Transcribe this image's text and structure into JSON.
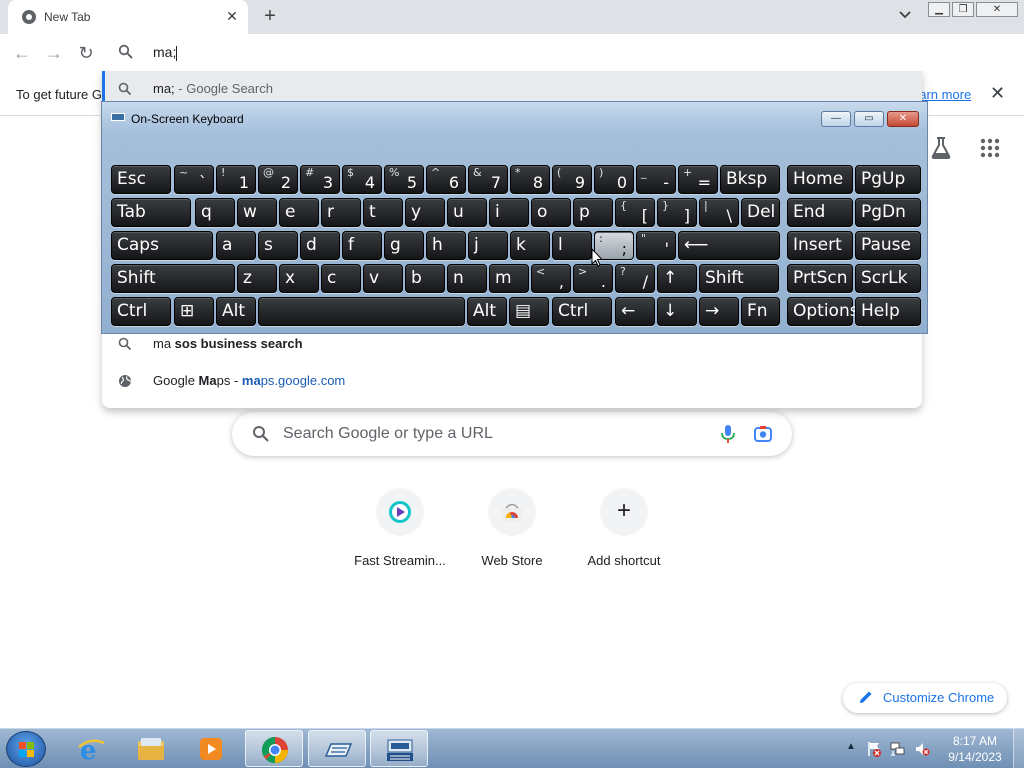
{
  "tab": {
    "title": "New Tab",
    "close_glyph": "✕"
  },
  "tabstrip": {
    "new_tab_glyph": "+",
    "tab_search_glyph": "⌄"
  },
  "window_controls": {
    "minimize": "▁",
    "maximize": "❐",
    "close": "✕"
  },
  "toolbar": {
    "back_glyph": "←",
    "forward_glyph": "→",
    "reload_glyph": "↻",
    "menu_glyph": "⋮"
  },
  "omnibox": {
    "value": "ma;"
  },
  "infobar": {
    "message": "To get future G",
    "link": "earn more",
    "close_glyph": "✕"
  },
  "suggestions": [
    {
      "pre": "ma; ",
      "bold": "",
      "post": "- Google Search",
      "url_bold": "",
      "url_rest": "",
      "icon": "search-icon"
    },
    {
      "pre": "ma ",
      "bold": "sos business search",
      "post": "",
      "url_bold": "",
      "url_rest": "",
      "icon": "search-icon"
    },
    {
      "pre": "Google ",
      "bold": "Ma",
      "post": "ps - ",
      "url_bold": "ma",
      "url_rest": "ps.google.com",
      "icon": "globe-icon"
    }
  ],
  "osk": {
    "title": "On-Screen Keyboard",
    "controls": {
      "minimize": "—",
      "maximize": "▭",
      "close": "✕"
    },
    "keys": [
      {
        "l": "Esc"
      },
      {
        "s": "~",
        "b": "`"
      },
      {
        "s": "!",
        "b": "1"
      },
      {
        "s": "@",
        "b": "2"
      },
      {
        "s": "#",
        "b": "3"
      },
      {
        "s": "$",
        "b": "4"
      },
      {
        "s": "%",
        "b": "5"
      },
      {
        "s": "^",
        "b": "6"
      },
      {
        "s": "&",
        "b": "7"
      },
      {
        "s": "*",
        "b": "8"
      },
      {
        "s": "(",
        "b": "9"
      },
      {
        "s": ")",
        "b": "0"
      },
      {
        "s": "_",
        "b": "-"
      },
      {
        "s": "+",
        "b": "="
      },
      {
        "l": "Bksp"
      },
      {
        "l": "Home"
      },
      {
        "l": "PgUp"
      },
      {
        "l": "Tab"
      },
      {
        "l": "q"
      },
      {
        "l": "w"
      },
      {
        "l": "e"
      },
      {
        "l": "r"
      },
      {
        "l": "t"
      },
      {
        "l": "y"
      },
      {
        "l": "u"
      },
      {
        "l": "i"
      },
      {
        "l": "o"
      },
      {
        "l": "p"
      },
      {
        "s": "{",
        "b": "["
      },
      {
        "s": "}",
        "b": "]"
      },
      {
        "s": "|",
        "b": "\\"
      },
      {
        "l": "Del"
      },
      {
        "l": "End"
      },
      {
        "l": "PgDn"
      },
      {
        "l": "Caps"
      },
      {
        "l": "a"
      },
      {
        "l": "s"
      },
      {
        "l": "d"
      },
      {
        "l": "f"
      },
      {
        "l": "g"
      },
      {
        "l": "h"
      },
      {
        "l": "j"
      },
      {
        "l": "k"
      },
      {
        "l": "l"
      },
      {
        "s": ":",
        "b": ";"
      },
      {
        "s": "\"",
        "b": "'"
      },
      {
        "l": "⟵"
      },
      {
        "l": "Insert"
      },
      {
        "l": "Pause"
      },
      {
        "l": "Shift"
      },
      {
        "l": "z"
      },
      {
        "l": "x"
      },
      {
        "l": "c"
      },
      {
        "l": "v"
      },
      {
        "l": "b"
      },
      {
        "l": "n"
      },
      {
        "l": "m"
      },
      {
        "s": "<",
        "b": ","
      },
      {
        "s": ">",
        "b": "."
      },
      {
        "s": "?",
        "b": "/"
      },
      {
        "l": "↑"
      },
      {
        "l": "Shift"
      },
      {
        "l": "PrtScn"
      },
      {
        "l": "ScrLk"
      },
      {
        "l": "Ctrl"
      },
      {
        "l": "⊞"
      },
      {
        "l": "Alt"
      },
      {
        "l": ""
      },
      {
        "l": "Alt"
      },
      {
        "l": "▤"
      },
      {
        "l": "Ctrl"
      },
      {
        "l": "←"
      },
      {
        "l": "↓"
      },
      {
        "l": "→"
      },
      {
        "l": "Fn"
      },
      {
        "l": "Options"
      },
      {
        "l": "Help"
      }
    ],
    "highlighted_key": ";"
  },
  "ntp": {
    "search_placeholder": "Search Google or type a URL",
    "shortcuts": [
      {
        "label": "Fast Streamin...",
        "icon": "play-icon"
      },
      {
        "label": "Web Store",
        "icon": "web-store-icon"
      },
      {
        "label": "Add shortcut",
        "icon": "plus-icon",
        "glyph": "+"
      }
    ],
    "customize_label": "Customize Chrome"
  },
  "taskbar": {
    "apps": [
      "internet-explorer-icon",
      "windows-explorer-icon",
      "media-player-icon",
      "chrome-icon",
      "on-screen-keyboard-icon",
      "keyboard-settings-icon"
    ],
    "tray_arrow": "▲",
    "time": "8:17 AM",
    "date": "9/14/2023"
  },
  "colors": {
    "accent": "#1a73e8",
    "tabstrip": "#dee1e6",
    "taskbar": "#7c9cc0"
  }
}
